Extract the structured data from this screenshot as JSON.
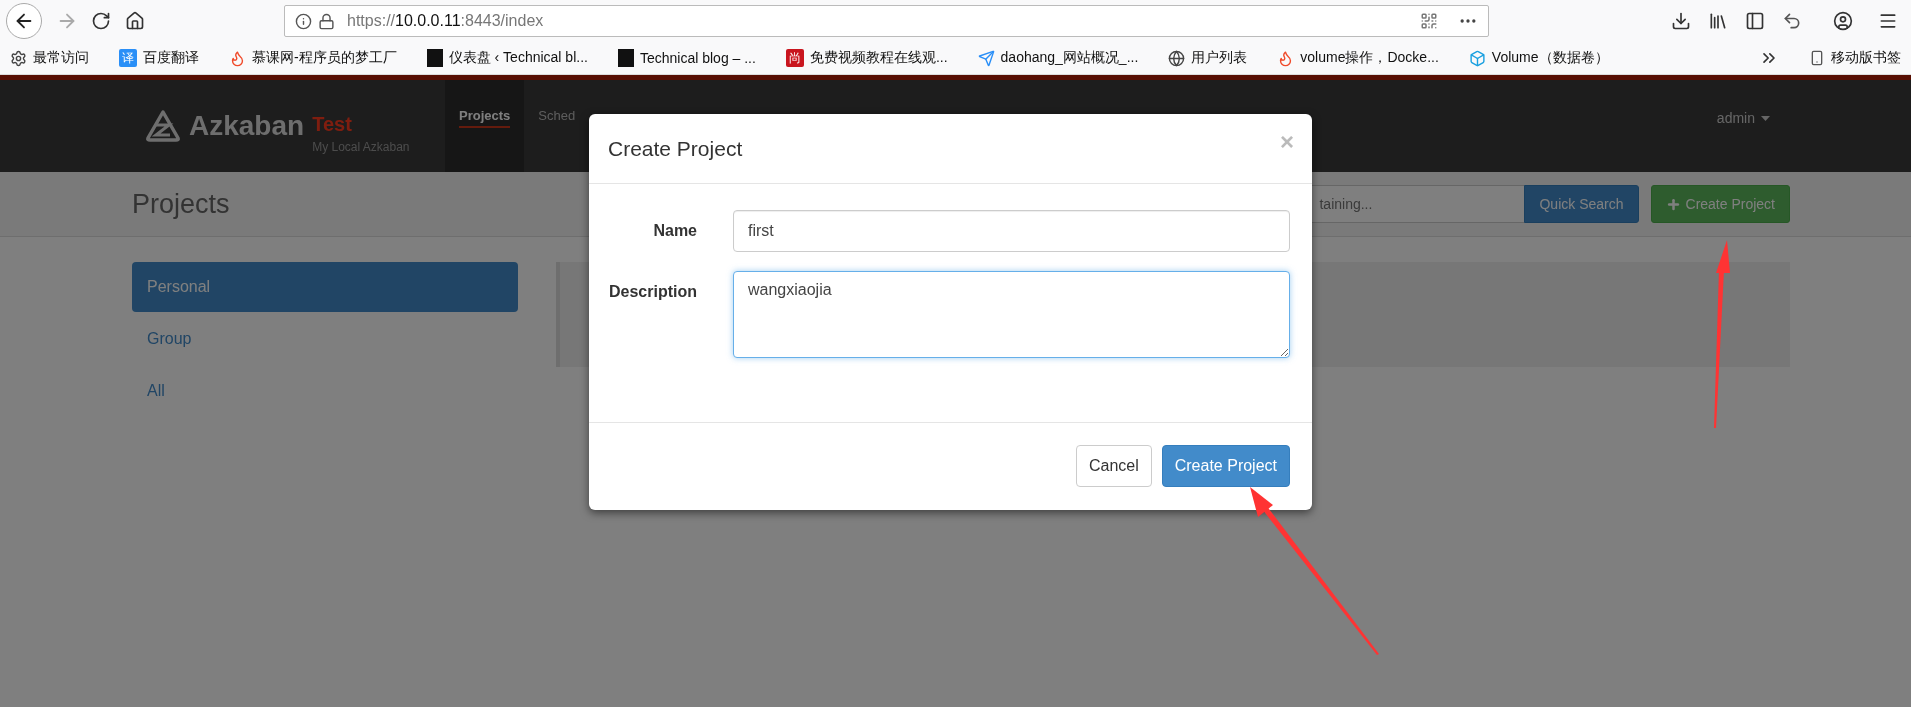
{
  "browser": {
    "url_scheme": "https://",
    "url_host": "10.0.0.11",
    "url_rest": ":8443/index",
    "bookmarks": [
      {
        "kind": "gear",
        "label": "最常访问"
      },
      {
        "kind": "tile",
        "glyph": "译",
        "label": "百度翻译"
      },
      {
        "kind": "flame",
        "label": "慕课网-程序员的梦工厂"
      },
      {
        "kind": "dark",
        "label": "仪表盘 ‹ Technical bl..."
      },
      {
        "kind": "dark",
        "label": "Technical blog – ..."
      },
      {
        "kind": "badge",
        "glyph": "尚",
        "label": "免费视频教程在线观..."
      },
      {
        "kind": "plane",
        "label": "daohang_网站概况_..."
      },
      {
        "kind": "globe",
        "label": "用户列表"
      },
      {
        "kind": "flame",
        "label": "volume操作，Docke..."
      },
      {
        "kind": "cube",
        "label": "Volume（数据卷）"
      }
    ],
    "mobile_bookmarks": "移动版书签"
  },
  "header": {
    "brand": "Azkaban",
    "env": "Test",
    "subtitle": "My Local Azkaban",
    "nav": [
      {
        "label": "Projects",
        "selected": true
      },
      {
        "label": "Sched",
        "selected": false
      }
    ],
    "user": "admin"
  },
  "toolbar": {
    "title": "Projects",
    "search_placeholder": "taining...",
    "search_button": "Quick Search",
    "create_button": "Create Project"
  },
  "sidebar": [
    {
      "label": "Personal",
      "selected": true
    },
    {
      "label": "Group",
      "selected": false
    },
    {
      "label": "All",
      "selected": false
    }
  ],
  "modal": {
    "title": "Create Project",
    "close": "×",
    "fields": [
      {
        "kind": "input",
        "label": "Name",
        "value": "first",
        "focused": false
      },
      {
        "kind": "textarea",
        "label": "Description",
        "value": "wangxiaojia",
        "focused": true
      }
    ],
    "buttons": [
      {
        "kind": "default",
        "label": "Cancel"
      },
      {
        "kind": "primary",
        "label": "Create Project"
      }
    ]
  }
}
